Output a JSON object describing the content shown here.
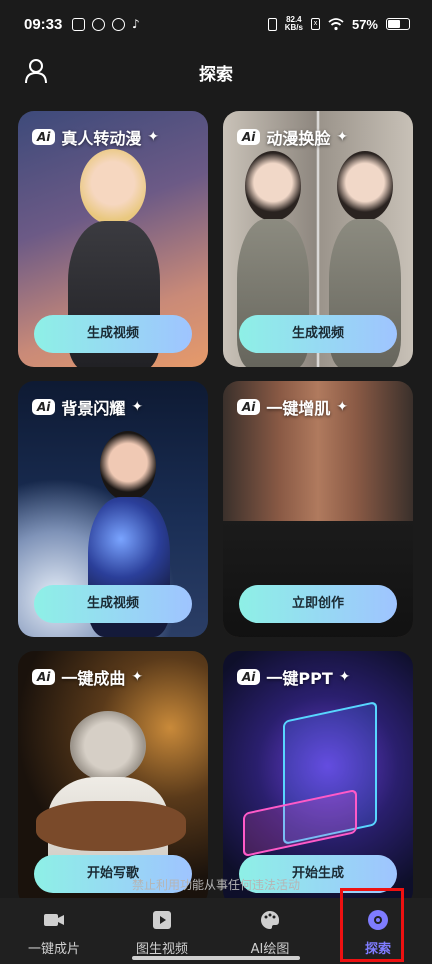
{
  "status_bar": {
    "time": "09:33",
    "net_speed_value": "82.4",
    "net_speed_unit": "KB/s",
    "battery": "57%"
  },
  "header": {
    "title": "探索"
  },
  "cards": [
    {
      "ai_badge": "Ai",
      "title": "真人转动漫",
      "sparkle": "✦",
      "button": "生成视频"
    },
    {
      "ai_badge": "Ai",
      "title": "动漫换脸",
      "sparkle": "✦",
      "button": "生成视频"
    },
    {
      "ai_badge": "Ai",
      "title": "背景闪耀",
      "sparkle": "✦",
      "button": "生成视频"
    },
    {
      "ai_badge": "Ai",
      "title": "一键增肌",
      "sparkle": "✦",
      "button": "立即创作"
    },
    {
      "ai_badge": "Ai",
      "title": "一键成曲",
      "sparkle": "✦",
      "button": "开始写歌"
    },
    {
      "ai_badge": "Ai",
      "title": "一键PPT",
      "sparkle": "✦",
      "button": "开始生成"
    }
  ],
  "notice": "禁止利用功能从事任何违法活动",
  "nav": {
    "items": [
      {
        "label": "一键成片",
        "icon": "video-camera-icon"
      },
      {
        "label": "图生视频",
        "icon": "play-square-icon"
      },
      {
        "label": "AI绘图",
        "icon": "palette-icon"
      },
      {
        "label": "探索",
        "icon": "explore-icon"
      }
    ],
    "active_color": "#7f7cff"
  }
}
